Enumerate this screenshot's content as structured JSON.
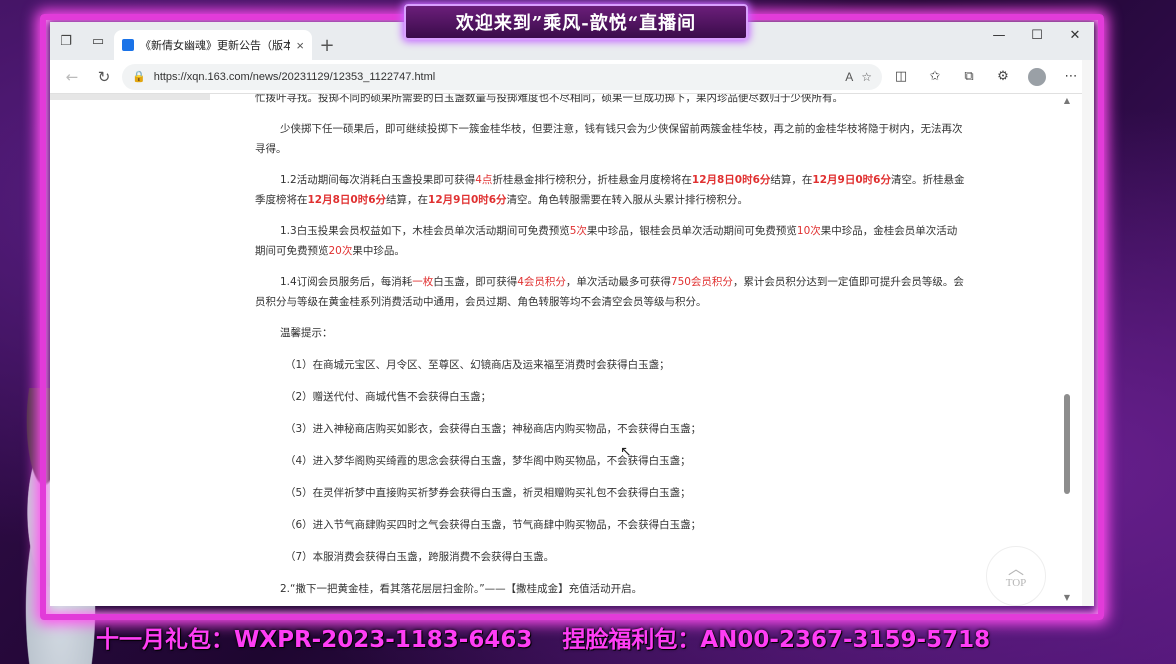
{
  "overlay": {
    "banner": "欢迎来到”乘风-歆悦“直播间",
    "gift_codes": [
      "十一月礼包：WXPR-2023-1183-6463",
      "捏脸福利包：AN00-2367-3159-5718"
    ]
  },
  "browser": {
    "tab_title": "《新倩女幽魂》更新公告（版本",
    "close_icon": "×",
    "new_tab": "+",
    "url": "https://xqn.163.com/news/20231129/12353_1122747.html",
    "win_min": "—",
    "win_max": "☐",
    "win_close": "✕"
  },
  "content": {
    "p0": "忙拨叶寻找。投掷不同的硕果所需要的白玉盏数量与投掷难度也不尽相同，硕果一旦成功掷下，果内珍品便尽数归于少侠所有。",
    "p1": "少侠掷下任一硕果后，即可继续投掷下一簇金桂华枝，但要注意，钱有钱只会为少侠保留前两簇金桂华枝，再之前的金桂华枝将隐于树内，无法再次寻得。",
    "p2_a": "1.2活动期间每次消耗白玉盏投果即可获得",
    "p2_b": "4点",
    "p2_c": "折桂悬金排行榜积分，折桂悬金月度榜将在",
    "p2_d": "12月8日0时6分",
    "p2_e": "结算，在",
    "p2_f": "12月9日0时6分",
    "p2_g": "清空。折桂悬金季度榜将在",
    "p2_h": "12月8日0时6分",
    "p2_i": "结算，在",
    "p2_j": "12月9日0时6分",
    "p2_k": "清空。角色转服需要在转入服从头累计排行榜积分。",
    "p3_a": "1.3白玉投果会员权益如下，木桂会员单次活动期间可免费预览",
    "p3_b": "5次",
    "p3_c": "果中珍品，银桂会员单次活动期间可免费预览",
    "p3_d": "10次",
    "p3_e": "果中珍品，金桂会员单次活动期间可免费预览",
    "p3_f": "20次",
    "p3_g": "果中珍品。",
    "p4_a": "1.4订阅会员服务后，每消耗",
    "p4_b": "一枚",
    "p4_c": "白玉盏，即可获得",
    "p4_d": "4会员积分",
    "p4_e": "，单次活动最多可获得",
    "p4_f": "750会员积分",
    "p4_g": "，累计会员积分达到一定值即可提升会员等级。会员积分与等级在黄金桂系列消费活动中通用，会员过期、角色转服等均不会清空会员等级与积分。",
    "tips_head": "温馨提示：",
    "tips": [
      "（1）在商城元宝区、月令区、至尊区、幻镜商店及运来福至消费时会获得白玉盏；",
      "（2）赠送代付、商城代售不会获得白玉盏；",
      "（3）进入神秘商店购买如影衣，会获得白玉盏；神秘商店内购买物品，不会获得白玉盏；",
      "（4）进入梦华阁购买绮霞的思念会获得白玉盏，梦华阁中购买物品，不会获得白玉盏；",
      "（5）在灵伴祈梦中直接购买祈梦券会获得白玉盏，祈灵相赠购买礼包不会获得白玉盏；",
      "（6）进入节气商肆购买四时之气会获得白玉盏，节气商肆中购买物品，不会获得白玉盏；",
      "（7）本服消费会获得白玉盏，跨服消费不会获得白玉盏。"
    ],
    "sec2": "2.“撒下一把黄金桂，看其落花层层扫金阶。”——【撒桂成金】充值活动开启。",
    "top_label": "TOP",
    "top_arrow": "︿"
  }
}
